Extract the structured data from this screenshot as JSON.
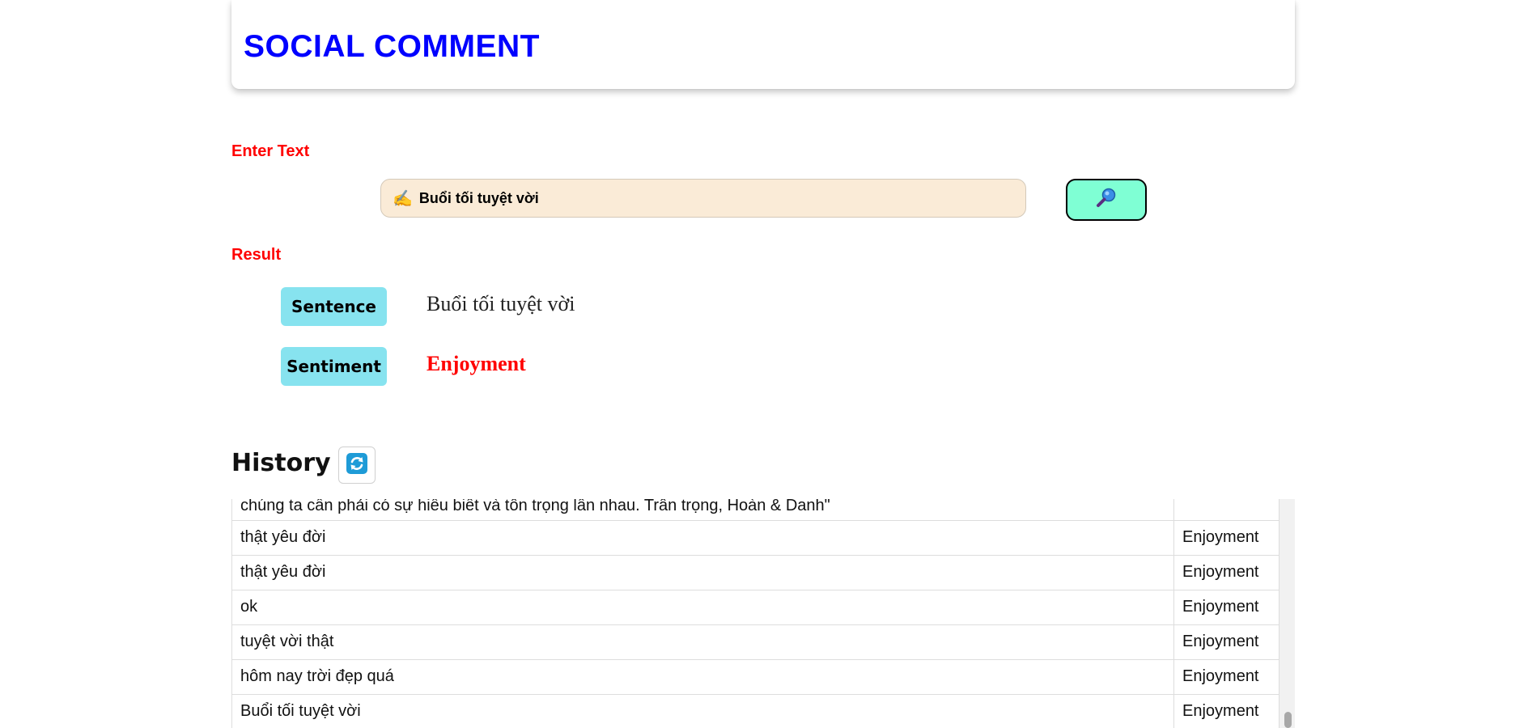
{
  "header": {
    "title": "SOCIAL COMMENT"
  },
  "input_section": {
    "label": "Enter Text",
    "icon": "writing-hand-icon",
    "value": "Buổi tối tuyệt vời",
    "search_icon": "magnifying-glass-icon"
  },
  "result": {
    "label": "Result",
    "sentence_label": "Sentence",
    "sentence_value": "Buổi tối tuyệt vời",
    "sentiment_label": "Sentiment",
    "sentiment_value": "Enjoyment",
    "sentiment_color": "#ff0000"
  },
  "history": {
    "title": "History",
    "refresh_icon": "refresh-icon",
    "rows": [
      {
        "text": "chúng ta cần phải có sự hiểu biết và tôn trọng lẫn nhau. Trân trọng, Hoàn & Danh\"",
        "sentiment": ""
      },
      {
        "text": "thật yêu đời",
        "sentiment": "Enjoyment"
      },
      {
        "text": "thật yêu đời",
        "sentiment": "Enjoyment"
      },
      {
        "text": "ok",
        "sentiment": "Enjoyment"
      },
      {
        "text": "tuyệt vời thật",
        "sentiment": "Enjoyment"
      },
      {
        "text": "hôm nay trời đẹp quá",
        "sentiment": "Enjoyment"
      },
      {
        "text": "Buổi tối tuyệt vời",
        "sentiment": "Enjoyment"
      }
    ]
  },
  "colors": {
    "title": "#0000ff",
    "label": "#ff0000",
    "input_bg": "#faebd7",
    "search_button_bg": "#7fffd4",
    "badge_bg": "#87e3ef",
    "refresh_icon_bg": "#1e9bd7"
  }
}
